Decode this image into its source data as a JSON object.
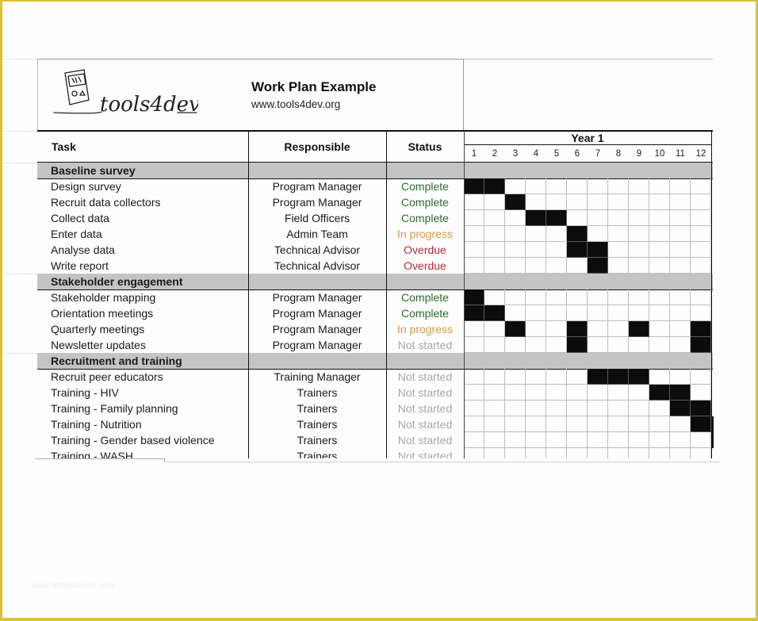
{
  "document": {
    "title": "Work Plan Example",
    "url": "www.tools4dev.org",
    "logo_text": "tools4dev",
    "watermark": "www.templateroo.com"
  },
  "columns": {
    "task": "Task",
    "responsible": "Responsible",
    "status": "Status",
    "year": "Year 1",
    "months": [
      "1",
      "2",
      "3",
      "4",
      "5",
      "6",
      "7",
      "8",
      "9",
      "10",
      "11",
      "12"
    ]
  },
  "status_colors": {
    "Complete": "#2e6b2e",
    "In progress": "#d39a4a",
    "Overdue": "#b52a35",
    "Not started": "#a8a8a8"
  },
  "sections": [
    {
      "name": "Baseline survey",
      "tasks": [
        {
          "task": "Design survey",
          "responsible": "Program Manager",
          "status": "Complete",
          "months": [
            1,
            2
          ]
        },
        {
          "task": "Recruit data collectors",
          "responsible": "Program Manager",
          "status": "Complete",
          "months": [
            3
          ]
        },
        {
          "task": "Collect data",
          "responsible": "Field Officers",
          "status": "Complete",
          "months": [
            4,
            5
          ]
        },
        {
          "task": "Enter data",
          "responsible": "Admin Team",
          "status": "In progress",
          "months": [
            6
          ]
        },
        {
          "task": "Analyse data",
          "responsible": "Technical Advisor",
          "status": "Overdue",
          "months": [
            6,
            7
          ]
        },
        {
          "task": "Write report",
          "responsible": "Technical Advisor",
          "status": "Overdue",
          "months": [
            7
          ]
        }
      ]
    },
    {
      "name": "Stakeholder engagement",
      "tasks": [
        {
          "task": "Stakeholder mapping",
          "responsible": "Program Manager",
          "status": "Complete",
          "months": [
            1
          ]
        },
        {
          "task": "Orientation meetings",
          "responsible": "Program Manager",
          "status": "Complete",
          "months": [
            1,
            2
          ]
        },
        {
          "task": "Quarterly meetings",
          "responsible": "Program Manager",
          "status": "In progress",
          "months": [
            3,
            6,
            9,
            12
          ]
        },
        {
          "task": "Newsletter updates",
          "responsible": "Program Manager",
          "status": "Not started",
          "months": [
            6,
            12
          ]
        }
      ]
    },
    {
      "name": "Recruitment and training",
      "tasks": [
        {
          "task": "Recruit peer educators",
          "responsible": "Training Manager",
          "status": "Not started",
          "months": [
            7,
            8,
            9
          ]
        },
        {
          "task": "Training - HIV",
          "responsible": "Trainers",
          "status": "Not started",
          "months": [
            10,
            11
          ]
        },
        {
          "task": "Training - Family planning",
          "responsible": "Trainers",
          "status": "Not started",
          "months": [
            11,
            12
          ]
        },
        {
          "task": "Training - Nutrition",
          "responsible": "Trainers",
          "status": "Not started",
          "months": [
            12
          ]
        },
        {
          "task": "Training - Gender based violence",
          "responsible": "Trainers",
          "status": "Not started",
          "months": []
        },
        {
          "task": "Training - WASH",
          "responsible": "Trainers",
          "status": "Not started",
          "months": []
        }
      ]
    }
  ]
}
